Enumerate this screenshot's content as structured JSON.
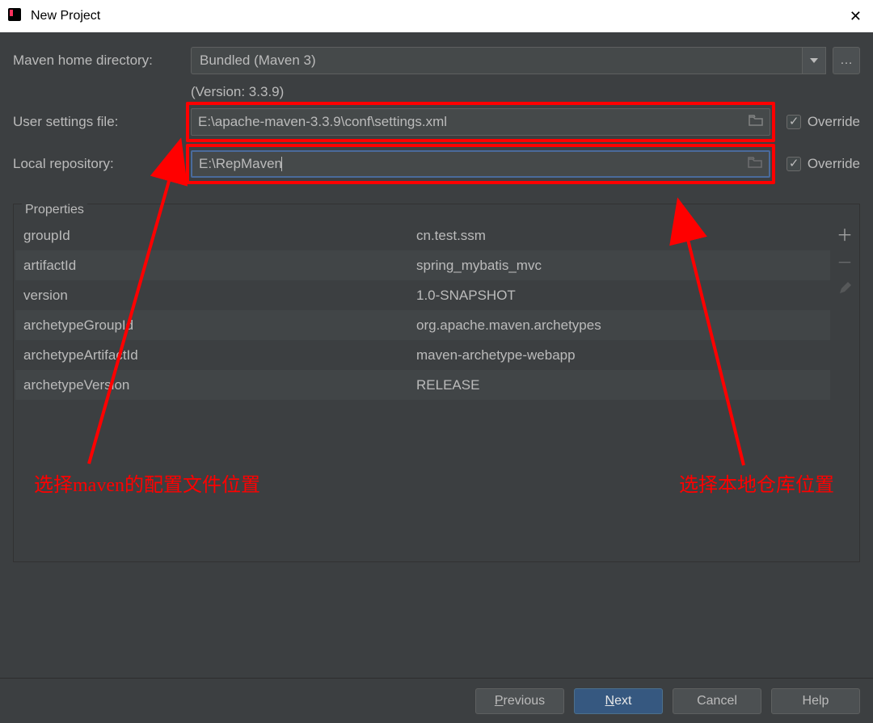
{
  "window": {
    "title": "New Project"
  },
  "form": {
    "maven_home_label": "Maven home directory:",
    "maven_home_value": "Bundled (Maven 3)",
    "version_text": "(Version: 3.3.9)",
    "user_settings_label": "User settings file:",
    "user_settings_value": "E:\\apache-maven-3.3.9\\conf\\settings.xml",
    "local_repo_label": "Local repository:",
    "local_repo_value": "E:\\RepMaven",
    "override_label": "Override"
  },
  "properties": {
    "title": "Properties",
    "rows": [
      {
        "key": "groupId",
        "value": "cn.test.ssm"
      },
      {
        "key": "artifactId",
        "value": "spring_mybatis_mvc"
      },
      {
        "key": "version",
        "value": "1.0-SNAPSHOT"
      },
      {
        "key": "archetypeGroupId",
        "value": "org.apache.maven.archetypes"
      },
      {
        "key": "archetypeArtifactId",
        "value": "maven-archetype-webapp"
      },
      {
        "key": "archetypeVersion",
        "value": "RELEASE"
      }
    ]
  },
  "annotations": {
    "left": "选择maven的配置文件位置",
    "right": "选择本地仓库位置"
  },
  "footer": {
    "previous": "Previous",
    "next": "Next",
    "cancel": "Cancel",
    "help": "Help"
  }
}
